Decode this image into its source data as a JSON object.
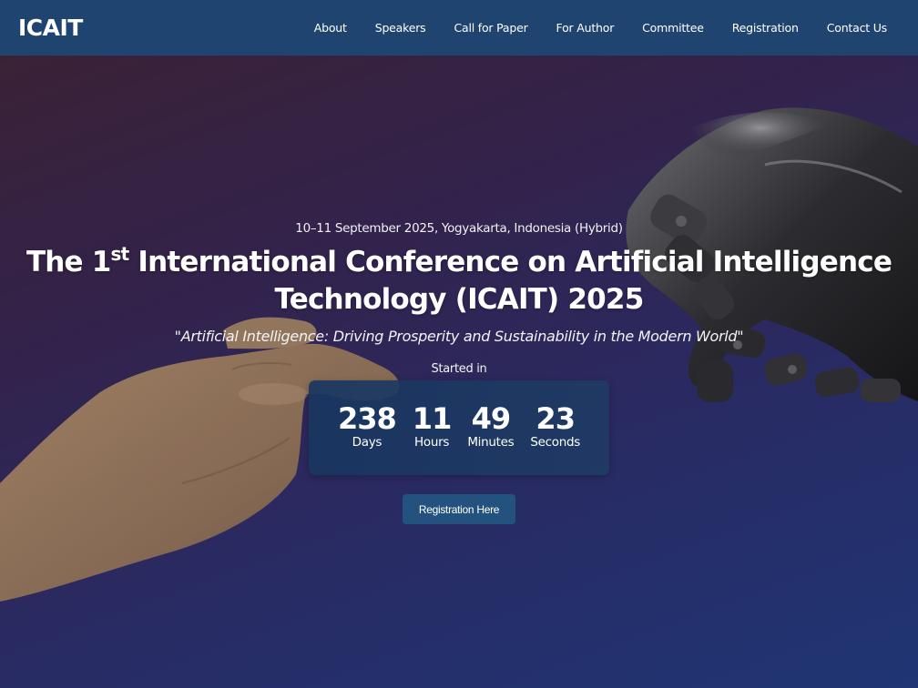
{
  "navbar": {
    "brand": "ICAIT",
    "links": [
      "About",
      "Speakers",
      "Call for Paper",
      "For Author",
      "Committee",
      "Registration",
      "Contact Us"
    ]
  },
  "hero": {
    "event_info": "10–11 September 2025, Yogyakarta, Indonesia (Hybrid)",
    "title_prefix": "The 1",
    "title_sup": "st",
    "title_line1_rest": " International Conference on Artificial Intelligence",
    "title_line2": "Technology (ICAIT) 2025",
    "theme": "\"Artificial Intelligence: Driving Prosperity and Sustainability in the Modern World\"",
    "started_label": "Started in",
    "countdown": [
      {
        "value": "238",
        "label": "Days"
      },
      {
        "value": "11",
        "label": "Hours"
      },
      {
        "value": "49",
        "label": "Minutes"
      },
      {
        "value": "23",
        "label": "Seconds"
      }
    ],
    "cta_label": "Registration Here"
  },
  "colors": {
    "navbar_bg": "#1f4470",
    "button_bg": "#24527f",
    "hero_gradient_start": "#3a2236",
    "hero_gradient_end": "#1f3574"
  },
  "icons": [
    "human-hand-image",
    "robot-hand-image"
  ]
}
